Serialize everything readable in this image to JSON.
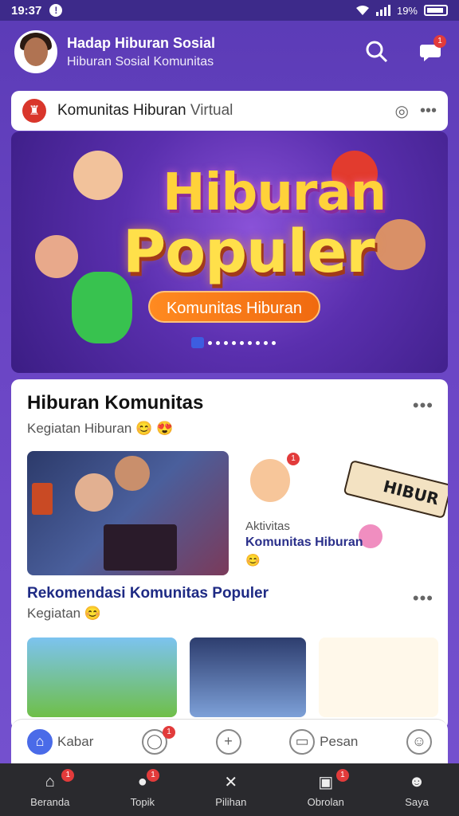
{
  "status_bar": {
    "time": "19:37",
    "notif_icon": "!",
    "right_text": "19%"
  },
  "header": {
    "title": "Hadap Hiburan Sosial",
    "subtitle": "Hiburan Sosial Komunitas"
  },
  "header_badges": {
    "notifications": "",
    "messages": "1"
  },
  "topic": {
    "title": "Komunitas Hiburan",
    "title_suffix": "Virtual"
  },
  "banner": {
    "line1": "Hiburan",
    "line2": "Populer",
    "button": "Komunitas Hiburan"
  },
  "feed": {
    "section_title": "Hiburan Komunitas",
    "section_sub": "Kegiatan Hiburan 😊 😍",
    "side_badge": "1",
    "side_text1": "Aktivitas",
    "side_text2": "Komunitas Hiburan",
    "side_text3": "😊",
    "sticker_text": "HIBUR",
    "section2_title": "Rekomendasi Komunitas Populer",
    "section2_sub": "Kegiatan 😊"
  },
  "tabs": [
    {
      "label": "Kabar",
      "icon": "home-icon"
    },
    {
      "label": "",
      "icon": "chat-icon",
      "badge": "1"
    },
    {
      "label": "",
      "icon": "add-icon"
    },
    {
      "label": "Pesan",
      "icon": "message-icon"
    },
    {
      "label": "",
      "icon": "profile-icon"
    }
  ],
  "bottom_nav": [
    {
      "label": "Beranda",
      "icon": "home-icon",
      "badge": "1"
    },
    {
      "label": "Topik",
      "icon": "chat-icon",
      "badge": "1"
    },
    {
      "label": "Pilihan",
      "icon": "explore-icon"
    },
    {
      "label": "Obrolan",
      "icon": "chat-bubble-icon",
      "badge": "1"
    },
    {
      "label": "Saya",
      "icon": "profile-icon"
    }
  ],
  "colors": {
    "header_bg": "#5b3bb6",
    "accent": "#4a6be8",
    "badge": "#e23b3b",
    "banner_button": "#f06a10"
  }
}
